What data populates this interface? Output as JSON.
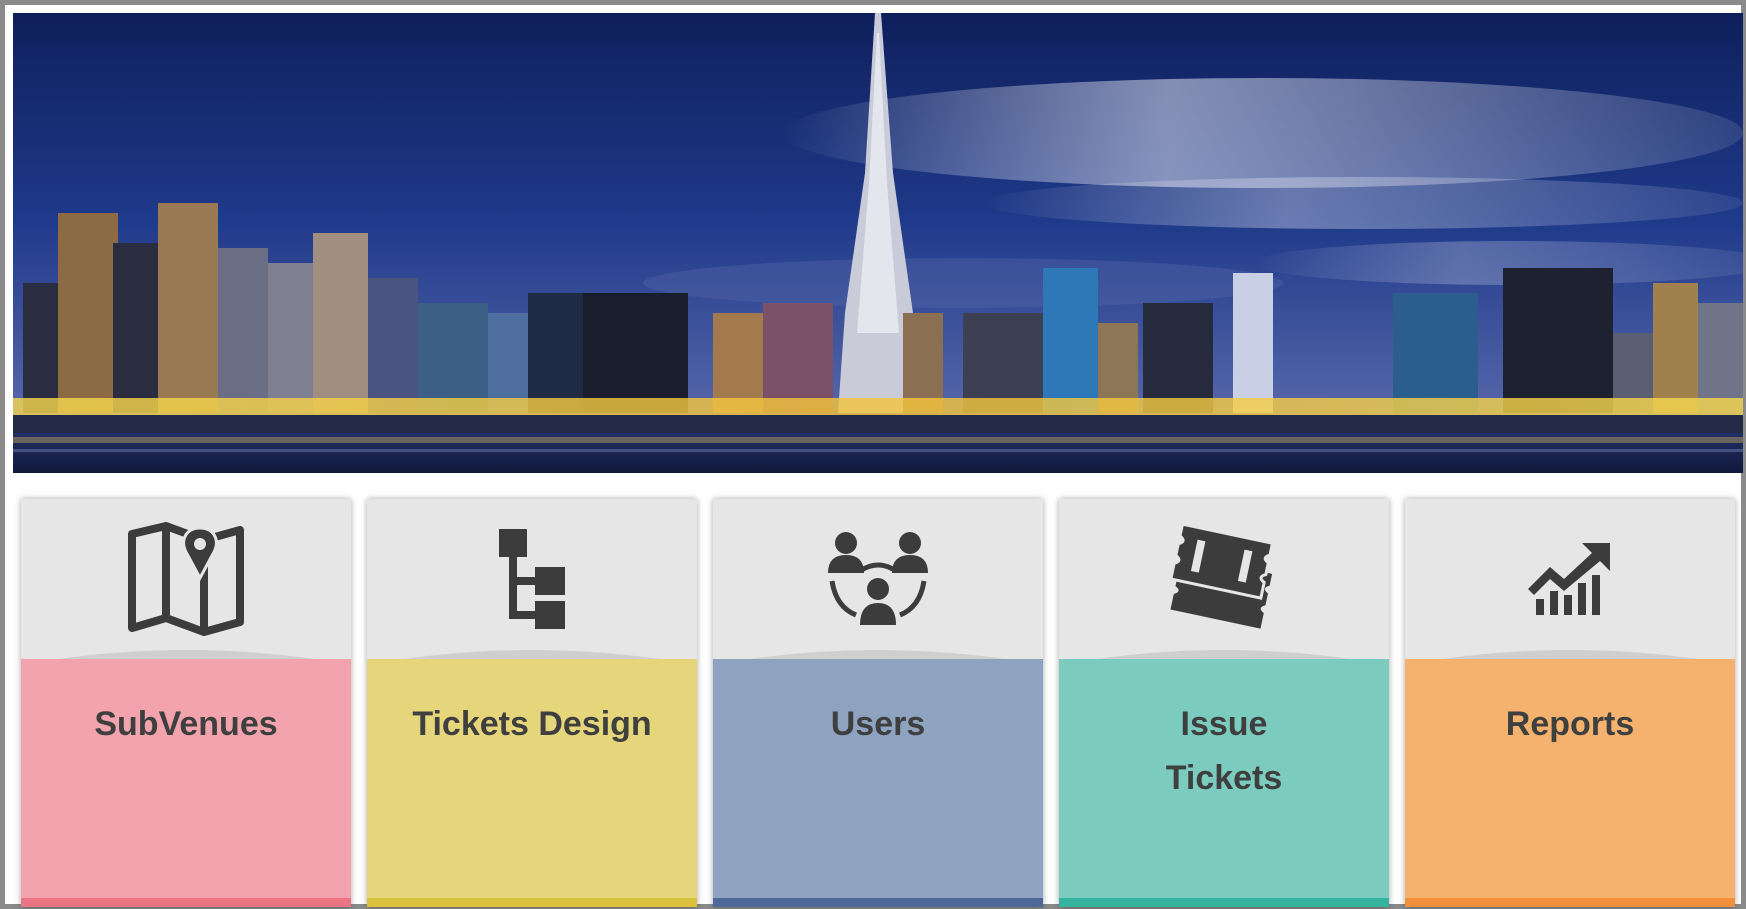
{
  "tiles": [
    {
      "id": "subvenues",
      "label": "SubVenues",
      "icon": "map-pin-icon",
      "color": "#f2a3ad",
      "accent": "#ec7585"
    },
    {
      "id": "tickets-design",
      "label": "Tickets Design",
      "icon": "hierarchy-icon",
      "color": "#e6d67b",
      "accent": "#d9c13c"
    },
    {
      "id": "users",
      "label": "Users",
      "icon": "users-group-icon",
      "color": "#8ea3c0",
      "accent": "#4f6897"
    },
    {
      "id": "issue-tickets",
      "label": "Issue\nTickets",
      "icon": "tickets-icon",
      "color": "#7bccbf",
      "accent": "#35b39c"
    },
    {
      "id": "reports",
      "label": "Reports",
      "icon": "chart-growth-icon",
      "color": "#f4b26e",
      "accent": "#f28f3c"
    }
  ],
  "colors": {
    "icon": "#3c3c3c",
    "label": "#3f3f3f",
    "tile_top": "#e6e6e6",
    "frame": "#8a8a8a"
  }
}
